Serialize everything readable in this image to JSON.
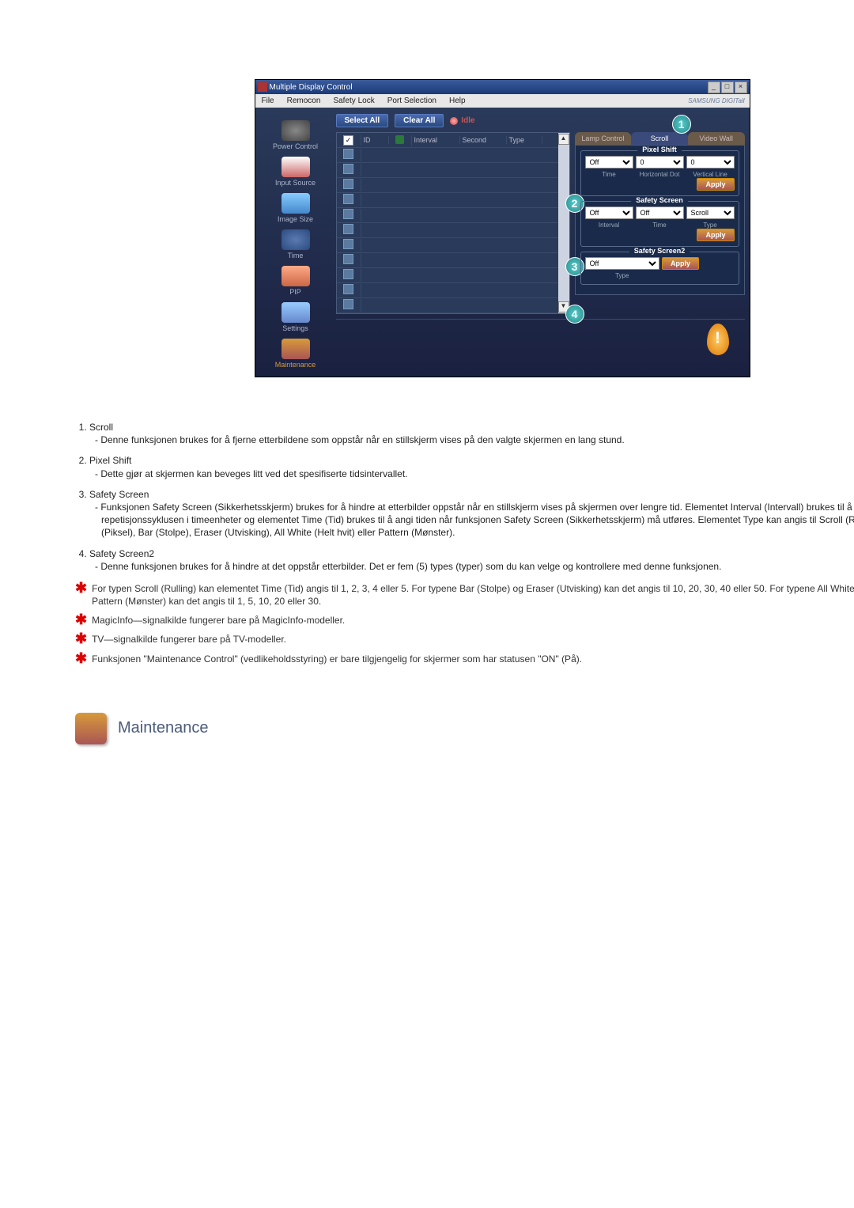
{
  "app": {
    "title": "Multiple Display Control",
    "brand": "SAMSUNG DIGITall",
    "menu": [
      "File",
      "Remocon",
      "Safety Lock",
      "Port Selection",
      "Help"
    ],
    "win_btns": [
      "_",
      "□",
      "×"
    ]
  },
  "sidebar": [
    "Power Control",
    "Input Source",
    "Image Size",
    "Time",
    "PIP",
    "Settings",
    "Maintenance"
  ],
  "toolbar": {
    "select_all": "Select All",
    "clear_all": "Clear All",
    "idle": "Idle"
  },
  "grid": {
    "headers": [
      "",
      "ID",
      "",
      "Interval",
      "Second",
      "Type"
    ],
    "scroll_up": "▲",
    "scroll_down": "▼"
  },
  "tabs": [
    "Lamp Control",
    "Scroll",
    "Video Wall"
  ],
  "pixel_shift": {
    "legend": "Pixel Shift",
    "vals": [
      "Off",
      "0",
      "0"
    ],
    "labs": [
      "Time",
      "Horizontal Dot",
      "Vertical Line"
    ],
    "apply": "Apply"
  },
  "safety_screen": {
    "legend": "Safety Screen",
    "vals": [
      "Off",
      "Off",
      "Scroll"
    ],
    "labs": [
      "Interval",
      "Time",
      "Type"
    ],
    "apply": "Apply"
  },
  "safety_screen2": {
    "legend": "Safety Screen2",
    "vals": [
      "Off"
    ],
    "labs": [
      "Type"
    ],
    "apply": "Apply"
  },
  "callouts": [
    "1",
    "2",
    "3",
    "4"
  ],
  "doc": {
    "i1t": "Scroll",
    "i1d": "- Denne funksjonen brukes for å fjerne etterbildene som oppstår når en stillskjerm vises på den valgte skjermen en lang stund.",
    "i2t": "Pixel Shift",
    "i2d": "- Dette gjør at skjermen kan beveges litt ved det spesifiserte tidsintervallet.",
    "i3t": "Safety Screen",
    "i3d": "- Funksjonen Safety Screen (Sikkerhetsskjerm) brukes for å hindre at etterbilder oppstår når en stillskjerm vises på skjermen over lengre tid.  Elementet Interval (Intervall) brukes til å angi repetisjonssyklusen i timeenheter og elementet Time (Tid) brukes til å angi tiden når funksjonen Safety Screen (Sikkerhetsskjerm) må utføres. Elementet Type kan angis til Scroll (Rulling), Pixel (Piksel), Bar (Stolpe), Eraser (Utvisking), All White (Helt hvit) eller Pattern (Mønster).",
    "i4t": "Safety Screen2",
    "i4d": "- Denne funksjonen brukes for å hindre at det oppstår etterbilder. Det er fem (5) types (typer) som du kan velge og kontrollere med denne funksjonen.",
    "n1": "For typen Scroll (Rulling) kan elementet Time (Tid) angis til 1, 2, 3, 4 eller 5. For typene Bar (Stolpe) og Eraser (Utvisking) kan det angis til 10, 20, 30, 40 eller 50. For typene All White (Helt hvit) og Pattern (Mønster) kan det angis til 1, 5, 10, 20 eller 30.",
    "n2": "MagicInfo—signalkilde fungerer bare på MagicInfo-modeller.",
    "n3": "TV—signalkilde fungerer bare på TV-modeller.",
    "n4": "Funksjonen \"Maintenance Control\" (vedlikeholdsstyring) er bare tilgjengelig for skjermer som har statusen \"ON\" (På)."
  },
  "section_heading": "Maintenance"
}
